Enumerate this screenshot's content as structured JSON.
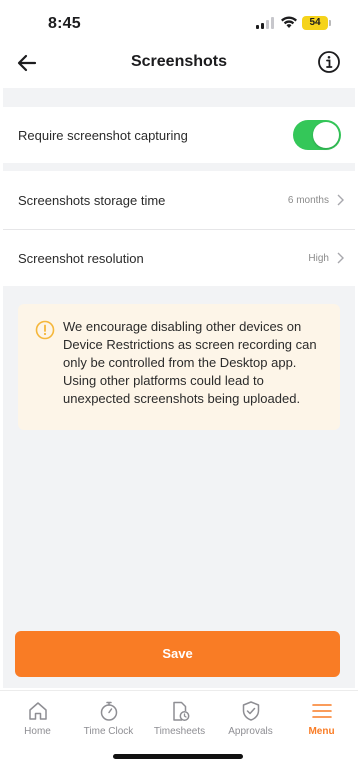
{
  "status_bar": {
    "time": "8:45",
    "battery": "54"
  },
  "header": {
    "title": "Screenshots"
  },
  "settings": {
    "require_capture": {
      "label": "Require screenshot capturing",
      "enabled": true
    },
    "storage_time": {
      "label": "Screenshots storage time",
      "value": "6 months"
    },
    "resolution": {
      "label": "Screenshot resolution",
      "value": "High"
    }
  },
  "warning": {
    "text": "We encourage disabling other devices on Device Restrictions as screen recording can only be controlled from the Desktop app. Using other platforms could lead to unexpected screenshots being uploaded."
  },
  "save_label": "Save",
  "tabbar": {
    "items": [
      {
        "label": "Home",
        "icon": "home-icon"
      },
      {
        "label": "Time Clock",
        "icon": "stopwatch-icon"
      },
      {
        "label": "Timesheets",
        "icon": "timesheet-icon"
      },
      {
        "label": "Approvals",
        "icon": "shield-check-icon"
      },
      {
        "label": "Menu",
        "icon": "menu-icon"
      }
    ],
    "active": "Menu"
  },
  "colors": {
    "accent": "#f97c25",
    "toggle_on": "#34c759",
    "warning_bg": "#fdf5e8",
    "warning_icon": "#f5b73b"
  }
}
